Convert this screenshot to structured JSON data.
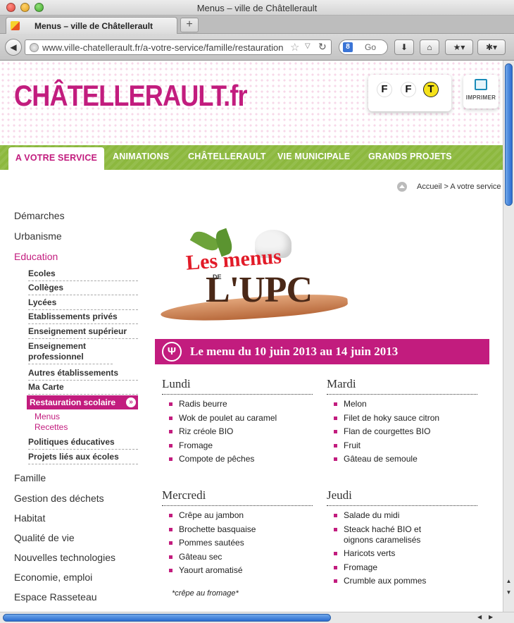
{
  "window": {
    "title": "Menus – ville de Châtellerault"
  },
  "tab": {
    "title": "Menus – ville de Châtellerault",
    "new_tab_label": "+"
  },
  "toolbar": {
    "url": "www.ville-chatellerault.fr/a-votre-service/famille/restauration",
    "search_placeholder": "Go",
    "search_engine_label": "8",
    "back_glyph": "◀",
    "star_glyph": "☆",
    "dropdown_glyph": "▽",
    "reload_glyph": "↻",
    "download_glyph": "⬇",
    "home_glyph": "⌂",
    "bookmarks_glyph": "★▾",
    "extensions_glyph": "✱▾"
  },
  "site": {
    "logo_main": "CHÂTELLERAULT",
    "logo_tld": ".fr",
    "font_small_label": "F",
    "font_big_label": "F",
    "font_contrast_label": "T",
    "print_label": "IMPRIMER"
  },
  "nav": {
    "items": [
      {
        "label": "A VOTRE SERVICE"
      },
      {
        "label": "ANIMATIONS"
      },
      {
        "label": "CHÂTELLERAULT"
      },
      {
        "label": "VIE MUNICIPALE"
      },
      {
        "label": "GRANDS PROJETS"
      }
    ]
  },
  "breadcrumb": {
    "text": "Accueil > A votre service >"
  },
  "sidebar": {
    "top_items": [
      "Démarches",
      "Urbanisme",
      "Education",
      "Famille",
      "Gestion des déchets",
      "Habitat",
      "Qualité de vie",
      "Nouvelles technologies",
      "Economie, emploi",
      "Espace Rasseteau"
    ],
    "education_sub": [
      "Ecoles",
      "Collèges",
      "Lycées",
      "Etablissements privés",
      "Enseignement supérieur",
      "Enseignement professionnel",
      "Autres établissements",
      "Ma Carte"
    ],
    "active_sub": "Restauration scolaire",
    "active_sub_arrow": "»",
    "active_children": [
      "Menus",
      "Recettes"
    ],
    "after_sub": [
      "Politiques éducatives",
      "Projets liés aux écoles"
    ]
  },
  "banner": {
    "les_menus": "Les menus",
    "de": "DE",
    "upc": "L'UPC"
  },
  "menu": {
    "title": "Le menu du 10 juin 2013 au 14 juin 2013",
    "icon_glyph": "Ψ",
    "days": [
      {
        "name": "Lundi",
        "dishes": [
          "Radis beurre",
          "Wok de poulet au caramel",
          "Riz créole BIO",
          "Fromage",
          "Compote de pêches"
        ]
      },
      {
        "name": "Mardi",
        "dishes": [
          "Melon",
          "Filet de hoky sauce citron",
          "Flan de courgettes BIO",
          "Fruit",
          "Gâteau de semoule"
        ]
      },
      {
        "name": "Mercredi",
        "dishes": [
          "Crêpe au jambon",
          "Brochette basquaise",
          "Pommes sautées",
          "Gâteau sec",
          "Yaourt aromatisé"
        ]
      },
      {
        "name": "Jeudi",
        "dishes": [
          "Salade du midi",
          "Steack haché BIO et oignons caramelisés",
          "Haricots verts",
          "Fromage",
          "Crumble aux pommes"
        ]
      }
    ],
    "footnote": "*crêpe au fromage*"
  },
  "scroll": {
    "up": "▲",
    "down": "▼",
    "left": "◀",
    "right": "▶"
  }
}
